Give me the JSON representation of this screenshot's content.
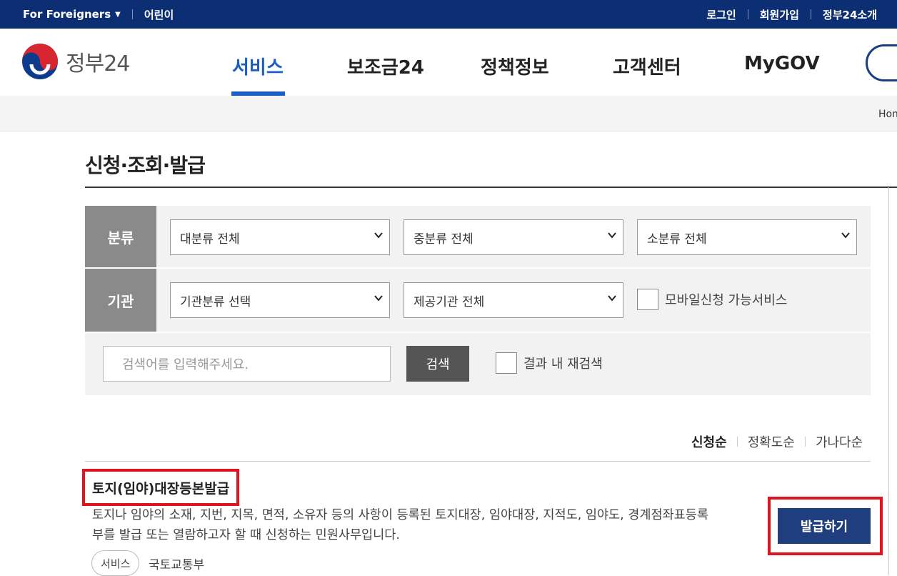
{
  "topbar": {
    "foreigners": "For Foreigners",
    "kids": "어린이",
    "login": "로그인",
    "signup": "회원가입",
    "about": "정부24소개"
  },
  "header": {
    "logo_text": "정부24",
    "nav": [
      "서비스",
      "보조금24",
      "정책정보",
      "고객센터",
      "MyGOV"
    ],
    "active_nav": "서비스"
  },
  "breadcrumb": {
    "home": "Hom"
  },
  "page": {
    "title": "신청·조회·발급"
  },
  "filter": {
    "category_label": "분류",
    "major": "대분류 전체",
    "middle": "중분류 전체",
    "minor": "소분류 전체",
    "agency_label": "기관",
    "agency_type": "기관분류 선택",
    "provider": "제공기관 전체",
    "mobile_check": "모바일신청 가능서비스",
    "search_placeholder": "검색어를 입력해주세요.",
    "search_button": "검색",
    "research_check": "결과 내 재검색"
  },
  "sort": {
    "items": [
      "신청순",
      "정확도순",
      "가나다순"
    ],
    "active": "신청순"
  },
  "result": {
    "title": "토지(임야)대장등본발급",
    "desc_line1": "토지나 임야의 소재, 지번, 지목, 면적, 소유자 등의 사항이 등록된 토지대장, 임야대장, 지적도, 임야도, 경계점좌표등록",
    "desc_line2": "부를 발급 또는 열람하고자 할 때 신청하는 민원사무입니다.",
    "tag": "서비스",
    "org": "국토교통부",
    "issue_button": "발급하기"
  },
  "colors": {
    "navy": "#0c2e72",
    "accent": "#1a5ec6",
    "highlight": "#e0141e",
    "button": "#1e3e7d"
  }
}
